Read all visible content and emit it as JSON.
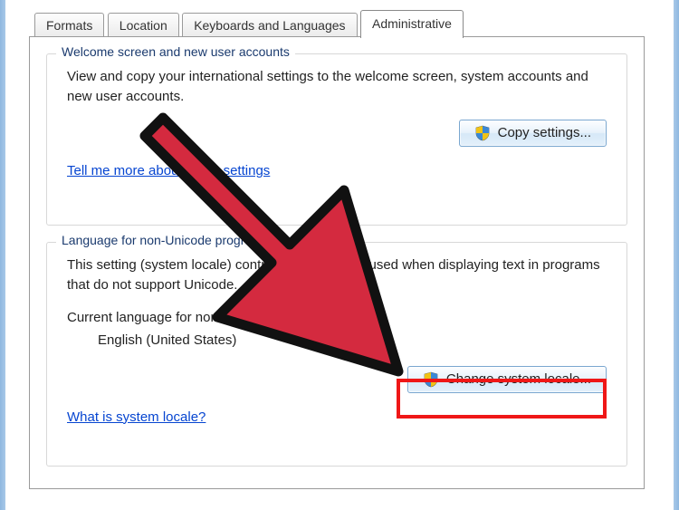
{
  "tabs": {
    "t0": "Formats",
    "t1": "Location",
    "t2": "Keyboards and Languages",
    "t3": "Administrative"
  },
  "group1": {
    "title": "Welcome screen and new user accounts",
    "desc": "View and copy your international settings to the welcome screen, system accounts and new user accounts.",
    "button": "Copy settings...",
    "link": "Tell me more about these settings"
  },
  "group2": {
    "title": "Language for non-Unicode programs",
    "desc": "This setting (system locale) controls the language used when displaying text in programs that do not support Unicode.",
    "row_label": "Current language for non-Unicode programs:",
    "row_value": "English (United States)",
    "button": "Change system locale...",
    "link": "What is system locale?"
  }
}
